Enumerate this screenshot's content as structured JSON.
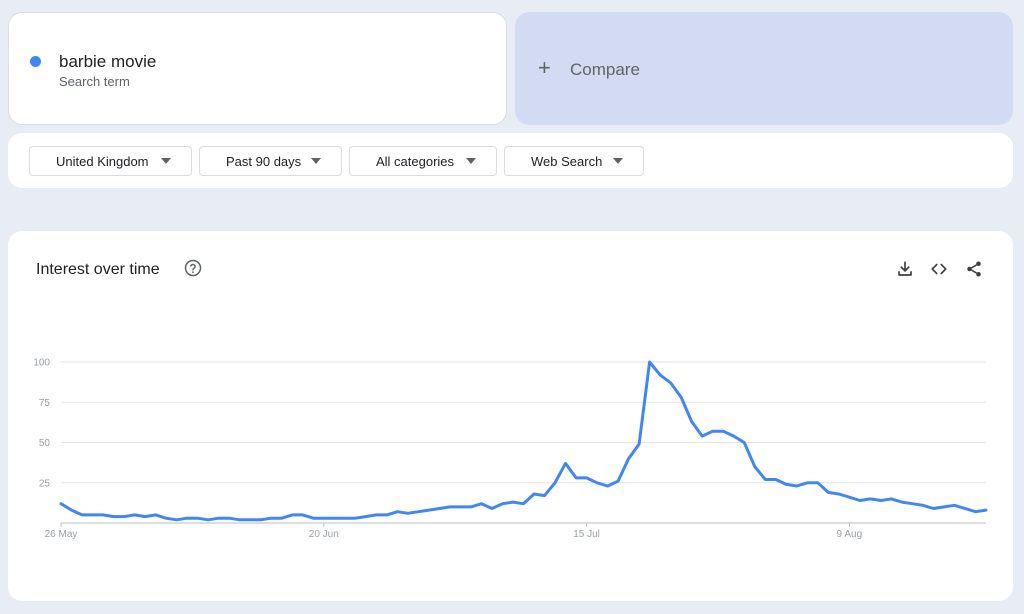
{
  "search_term": {
    "name": "barbie movie",
    "subtitle": "Search term",
    "color": "#4285f4"
  },
  "compare": {
    "icon": "plus-icon",
    "label": "Compare"
  },
  "filters": [
    {
      "label": "United Kingdom"
    },
    {
      "label": "Past 90 days"
    },
    {
      "label": "All categories"
    },
    {
      "label": "Web Search"
    }
  ],
  "chart_panel": {
    "title": "Interest over time",
    "help_icon": "help-icon",
    "tools": [
      "download-icon",
      "embed-code-icon",
      "share-icon"
    ]
  },
  "chart_data": {
    "type": "line",
    "title": "Interest over time",
    "xlabel": "",
    "ylabel": "",
    "ylim": [
      0,
      100
    ],
    "yticks": [
      25,
      50,
      75,
      100
    ],
    "x_tick_labels": [
      {
        "label": "26 May",
        "index": 0
      },
      {
        "label": "20 Jun",
        "index": 25
      },
      {
        "label": "15 Jul",
        "index": 50
      },
      {
        "label": "9 Aug",
        "index": 75
      }
    ],
    "grid": true,
    "series": [
      {
        "color": "#4285f4",
        "values": [
          12,
          8,
          5,
          5,
          5,
          4,
          4,
          5,
          4,
          5,
          3,
          2,
          3,
          3,
          2,
          3,
          3,
          2,
          2,
          2,
          3,
          3,
          5,
          5,
          3,
          3,
          3,
          3,
          3,
          4,
          5,
          5,
          7,
          6,
          7,
          8,
          9,
          10,
          10,
          10,
          12,
          9,
          12,
          13,
          12,
          18,
          17,
          25,
          37,
          28,
          28,
          25,
          23,
          26,
          40,
          49,
          100,
          92,
          87,
          78,
          63,
          54,
          57,
          57,
          54,
          50,
          35,
          27,
          27,
          24,
          23,
          25,
          25,
          19,
          18,
          16,
          14,
          15,
          14,
          15,
          13,
          12,
          11,
          9,
          10,
          11,
          9,
          7,
          8
        ]
      }
    ]
  }
}
